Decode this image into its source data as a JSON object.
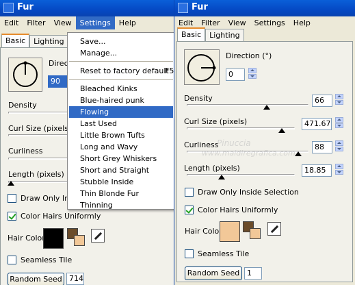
{
  "back_window": {
    "title": "Fur",
    "menu": [
      "Edit",
      "Filter",
      "View",
      "Settings",
      "Help"
    ],
    "tabs": [
      "Basic",
      "Lighting"
    ],
    "direction_label": "Directi",
    "direction_value": "90",
    "density_label": "Density",
    "curl_size_label": "Curl Size (pixels)",
    "curliness_label": "Curliness",
    "length_label": "Length (pixels)",
    "draw_only_inside_label": "Draw Only Insid",
    "color_hairs_uniformly_label": "Color Hairs Uniformly",
    "hair_color_label": "Hair Color",
    "hair_color_hex": "#000000",
    "seamless_tile_label": "Seamless Tile",
    "random_seed_label": "Random Seed",
    "random_seed_value": "714"
  },
  "settings_menu": {
    "items": [
      {
        "label": "Save...",
        "shortcut": ""
      },
      {
        "label": "Manage...",
        "shortcut": ""
      },
      {
        "label": "Reset to factory default",
        "shortcut": "F5"
      },
      {
        "label": "Bleached Kinks"
      },
      {
        "label": "Blue-haired punk"
      },
      {
        "label": "Flowing"
      },
      {
        "label": "Last Used"
      },
      {
        "label": "Little Brown Tufts"
      },
      {
        "label": "Long and Wavy"
      },
      {
        "label": "Short Grey Whiskers"
      },
      {
        "label": "Short and Straight"
      },
      {
        "label": "Stubble Inside"
      },
      {
        "label": "Thin Blonde Fur"
      },
      {
        "label": "Thinning"
      }
    ],
    "highlighted": "Flowing"
  },
  "front_window": {
    "title": "Fur",
    "menu": [
      "Edit",
      "Filter",
      "View",
      "Settings",
      "Help"
    ],
    "tabs": [
      "Basic",
      "Lighting"
    ],
    "direction_label": "Direction (°)",
    "direction_value": "0",
    "density_label": "Density",
    "density_value": "66",
    "curl_size_label": "Curl Size (pixels)",
    "curl_size_value": "471.67",
    "curliness_label": "Curliness",
    "curliness_value": "88",
    "length_label": "Length (pixels)",
    "length_value": "18.85",
    "draw_only_inside_label": "Draw Only Inside Selection",
    "draw_only_inside_checked": false,
    "color_hairs_uniformly_label": "Color Hairs Uniformly",
    "color_hairs_uniformly_checked": true,
    "hair_color_label": "Hair Color",
    "hair_color_hex": "#f2c898",
    "seamless_tile_label": "Seamless Tile",
    "seamless_tile_checked": false,
    "random_seed_label": "Random Seed",
    "random_seed_value": "1"
  },
  "watermark": {
    "line1": "Pinuccia",
    "line2": "www.maldiregrafica.com"
  },
  "colors": {
    "title_bar": "#0549c4",
    "highlight": "#316ac5",
    "window_bg": "#ece9d8",
    "brown": "#6b4c2a",
    "tan": "#f2c898"
  }
}
